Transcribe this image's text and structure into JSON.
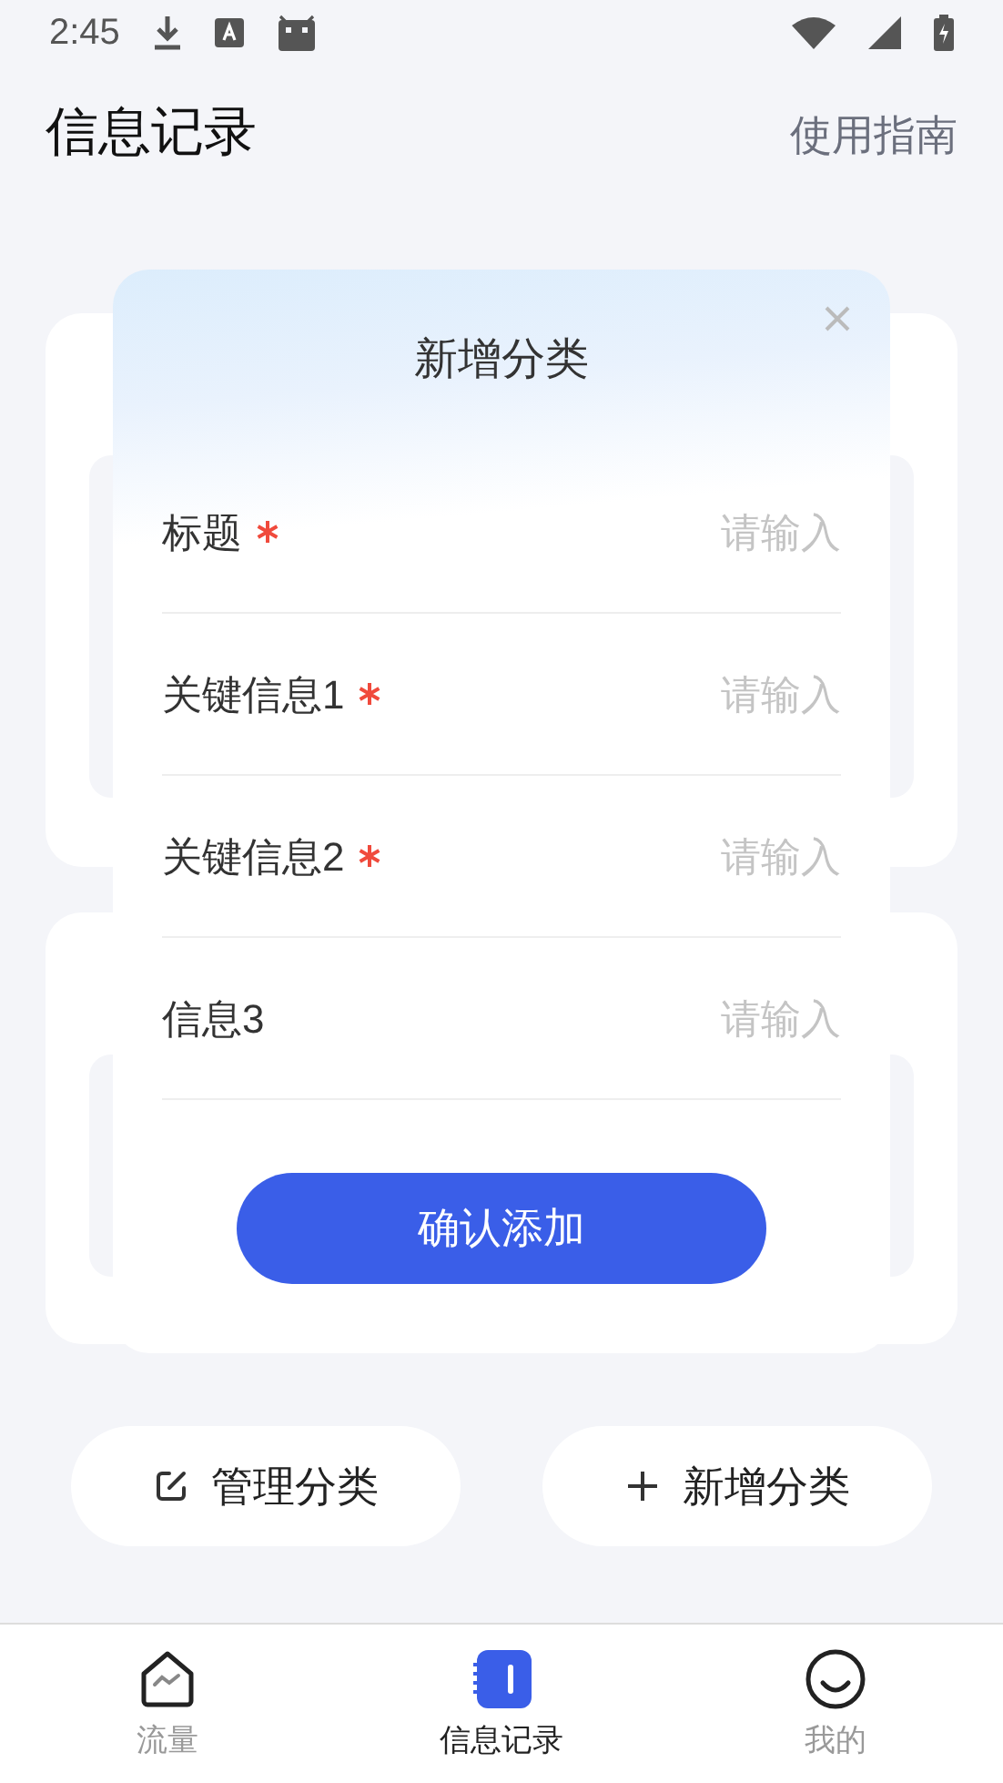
{
  "status_bar": {
    "time": "2:45"
  },
  "header": {
    "title": "信息记录",
    "guide_link": "使用指南"
  },
  "dialog": {
    "title": "新增分类",
    "fields": [
      {
        "label": "标题",
        "required": true,
        "placeholder": "请输入"
      },
      {
        "label": "关键信息1",
        "required": true,
        "placeholder": "请输入"
      },
      {
        "label": "关键信息2",
        "required": true,
        "placeholder": "请输入"
      },
      {
        "label": "信息3",
        "required": false,
        "placeholder": "请输入"
      }
    ],
    "confirm_button": "确认添加"
  },
  "actions": [
    {
      "kind": "edit",
      "label": "管理分类"
    },
    {
      "kind": "add",
      "label": "新增分类"
    }
  ],
  "bottom_nav": [
    {
      "kind": "traffic",
      "label": "流量",
      "selected": false
    },
    {
      "kind": "records",
      "label": "信息记录",
      "selected": true
    },
    {
      "kind": "profile",
      "label": "我的",
      "selected": false
    }
  ]
}
